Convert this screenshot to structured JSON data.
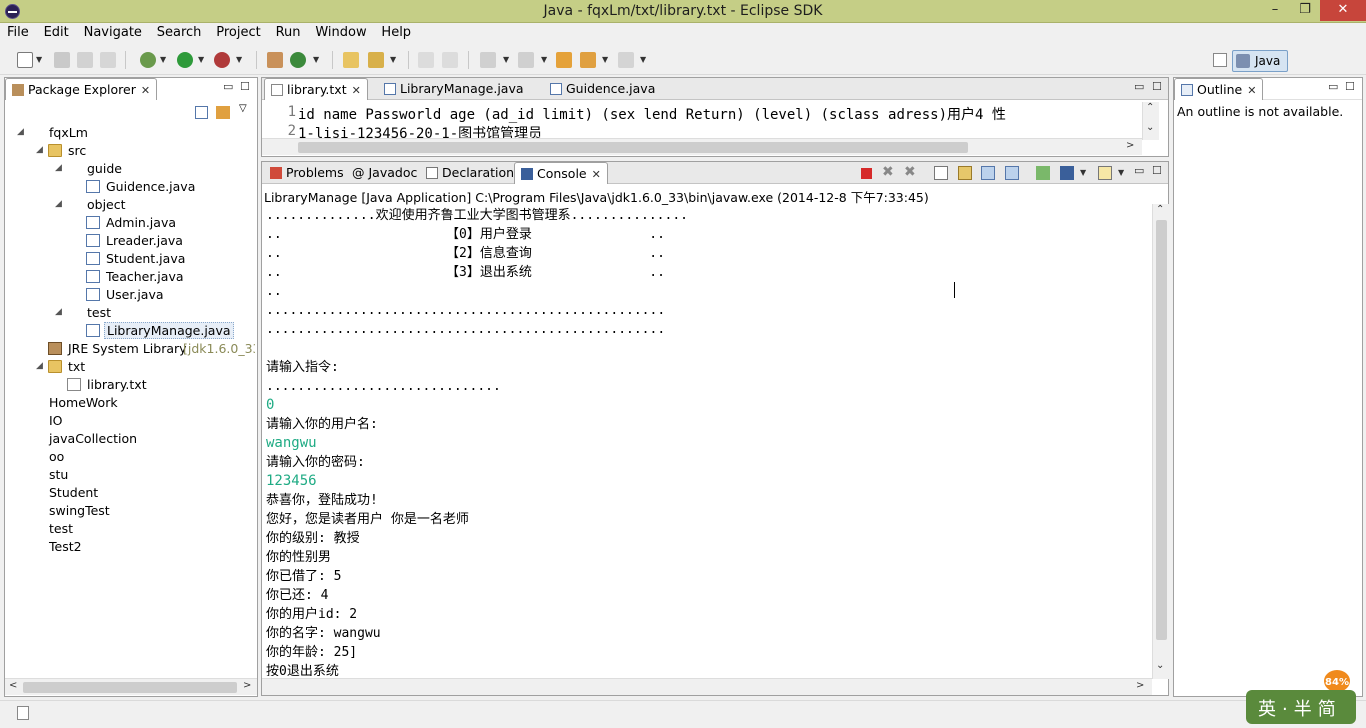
{
  "window": {
    "title": "Java - fqxLm/txt/library.txt - Eclipse SDK",
    "minimize": "–",
    "maximize": "❐",
    "close": "✕"
  },
  "menu": [
    "File",
    "Edit",
    "Navigate",
    "Search",
    "Project",
    "Run",
    "Window",
    "Help"
  ],
  "perspective": {
    "label": "Java"
  },
  "package_explorer": {
    "title": "Package Explorer",
    "tree": [
      {
        "label": "fqxLm",
        "type": "project",
        "depth": 0,
        "expanded": true
      },
      {
        "label": "src",
        "type": "folder",
        "depth": 1,
        "expanded": true
      },
      {
        "label": "guide",
        "type": "package",
        "depth": 2,
        "expanded": true
      },
      {
        "label": "Guidence.java",
        "type": "java",
        "depth": 3
      },
      {
        "label": "object",
        "type": "package",
        "depth": 2,
        "expanded": true
      },
      {
        "label": "Admin.java",
        "type": "java",
        "depth": 3
      },
      {
        "label": "Lreader.java",
        "type": "java",
        "depth": 3
      },
      {
        "label": "Student.java",
        "type": "java",
        "depth": 3
      },
      {
        "label": "Teacher.java",
        "type": "java",
        "depth": 3
      },
      {
        "label": "User.java",
        "type": "java",
        "depth": 3
      },
      {
        "label": "test",
        "type": "package",
        "depth": 2,
        "expanded": true
      },
      {
        "label": "LibraryManage.java",
        "type": "java",
        "depth": 3,
        "selected": true
      },
      {
        "label": "JRE System Library",
        "decoration": "[jdk1.6.0_33]",
        "type": "lib",
        "depth": 1
      },
      {
        "label": "txt",
        "type": "folder",
        "depth": 1,
        "expanded": true
      },
      {
        "label": "library.txt",
        "type": "txt",
        "depth": 2
      },
      {
        "label": "HomeWork",
        "type": "project",
        "depth": 0
      },
      {
        "label": "IO",
        "type": "project",
        "depth": 0
      },
      {
        "label": "javaCollection",
        "type": "project",
        "depth": 0
      },
      {
        "label": "oo",
        "type": "project",
        "depth": 0
      },
      {
        "label": "stu",
        "type": "project",
        "depth": 0
      },
      {
        "label": "Student",
        "type": "project",
        "depth": 0
      },
      {
        "label": "swingTest",
        "type": "project",
        "depth": 0
      },
      {
        "label": "test",
        "type": "project",
        "depth": 0
      },
      {
        "label": "Test2",
        "type": "project",
        "depth": 0
      }
    ]
  },
  "editor": {
    "tabs": [
      {
        "label": "library.txt",
        "active": true
      },
      {
        "label": "LibraryManage.java",
        "active": false
      },
      {
        "label": "Guidence.java",
        "active": false
      }
    ],
    "lines": [
      {
        "num": "1",
        "text": "id  name    Passworld  age  (ad_id  limit)  (sex  lend  Return)  (level) (sclass adress)用户4 性"
      },
      {
        "num": "2",
        "text": "1-lisi-123456-20-1-图书馆管理员"
      }
    ]
  },
  "console": {
    "tabs": [
      {
        "label": "Problems",
        "active": false
      },
      {
        "label": "Javadoc",
        "active": false
      },
      {
        "label": "Declaration",
        "active": false
      },
      {
        "label": "Console",
        "active": true
      }
    ],
    "process": "LibraryManage [Java Application] C:\\Program Files\\Java\\jdk1.6.0_33\\bin\\javaw.exe (2014-12-8 下午7:33:45)",
    "output": [
      {
        "text": "..............欢迎使用齐鲁工业大学图书管理系...............",
        "kind": "out"
      },
      {
        "text": "..                     【0】用户登录               ..",
        "kind": "out"
      },
      {
        "text": "..                     【2】信息查询               ..",
        "kind": "out"
      },
      {
        "text": "..                     【3】退出系统               ..",
        "kind": "out"
      },
      {
        "text": "..",
        "kind": "out"
      },
      {
        "text": "...................................................",
        "kind": "out"
      },
      {
        "text": "...................................................",
        "kind": "out"
      },
      {
        "text": "",
        "kind": "out"
      },
      {
        "text": "请输入指令:",
        "kind": "out"
      },
      {
        "text": "..............................",
        "kind": "out"
      },
      {
        "text": "0",
        "kind": "input"
      },
      {
        "text": "请输入你的用户名:",
        "kind": "out"
      },
      {
        "text": "wangwu",
        "kind": "input"
      },
      {
        "text": "请输入你的密码:",
        "kind": "out"
      },
      {
        "text": "123456",
        "kind": "input"
      },
      {
        "text": "恭喜你，登陆成功!",
        "kind": "out"
      },
      {
        "text": "您好，您是读者用户 你是一名老师",
        "kind": "out"
      },
      {
        "text": "你的级别: 教授",
        "kind": "out"
      },
      {
        "text": "你的性别男",
        "kind": "out"
      },
      {
        "text": "你已借了: 5",
        "kind": "out"
      },
      {
        "text": "你已还: 4",
        "kind": "out"
      },
      {
        "text": "你的用户id: 2",
        "kind": "out"
      },
      {
        "text": "你的名字: wangwu",
        "kind": "out"
      },
      {
        "text": "你的年龄: 25]",
        "kind": "out"
      },
      {
        "text": "按0退出系统",
        "kind": "out"
      }
    ]
  },
  "outline": {
    "title": "Outline",
    "message": "An outline is not available."
  },
  "tray": {
    "ime": "英·半简",
    "battery": "84%"
  },
  "colors": {
    "titlebar": "#c5ce86",
    "console_input": "#1fab84",
    "close_button": "#c7453b"
  }
}
